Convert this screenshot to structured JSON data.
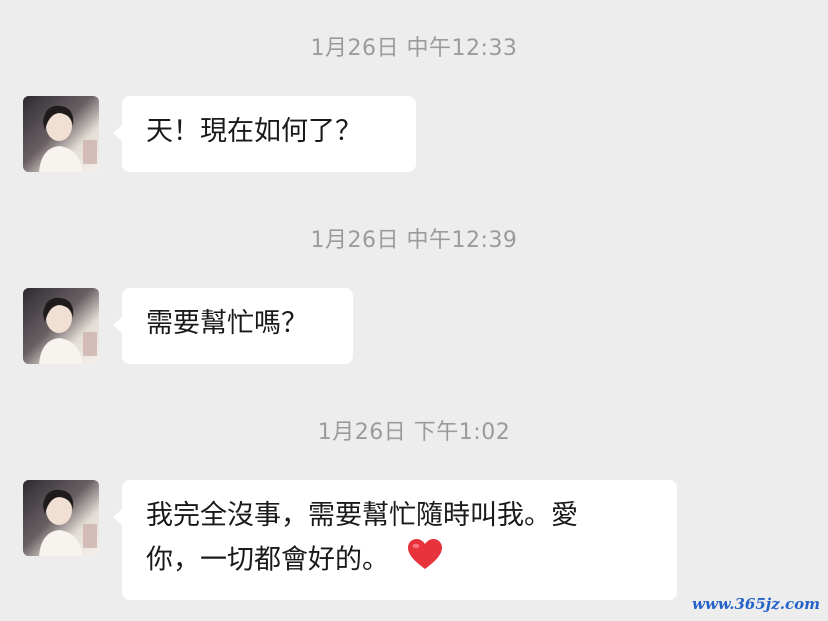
{
  "messages": [
    {
      "timestamp": "1月26日 中午12:33",
      "text": "天！現在如何了？"
    },
    {
      "timestamp": "1月26日 中午12:39",
      "text": "需要幫忙嗎？"
    },
    {
      "timestamp": "1月26日 下午1:02",
      "line1": "我完全沒事，需要幫忙隨時叫我。愛",
      "line2": "你，一切都會好的。",
      "emoji": "heart-emoji"
    }
  ],
  "watermark": "www.365jz.com",
  "colors": {
    "background": "#ededed",
    "bubble": "#ffffff",
    "timestamp": "#9b9b9b",
    "heart": "#e8323c",
    "watermark": "#2563c9"
  }
}
